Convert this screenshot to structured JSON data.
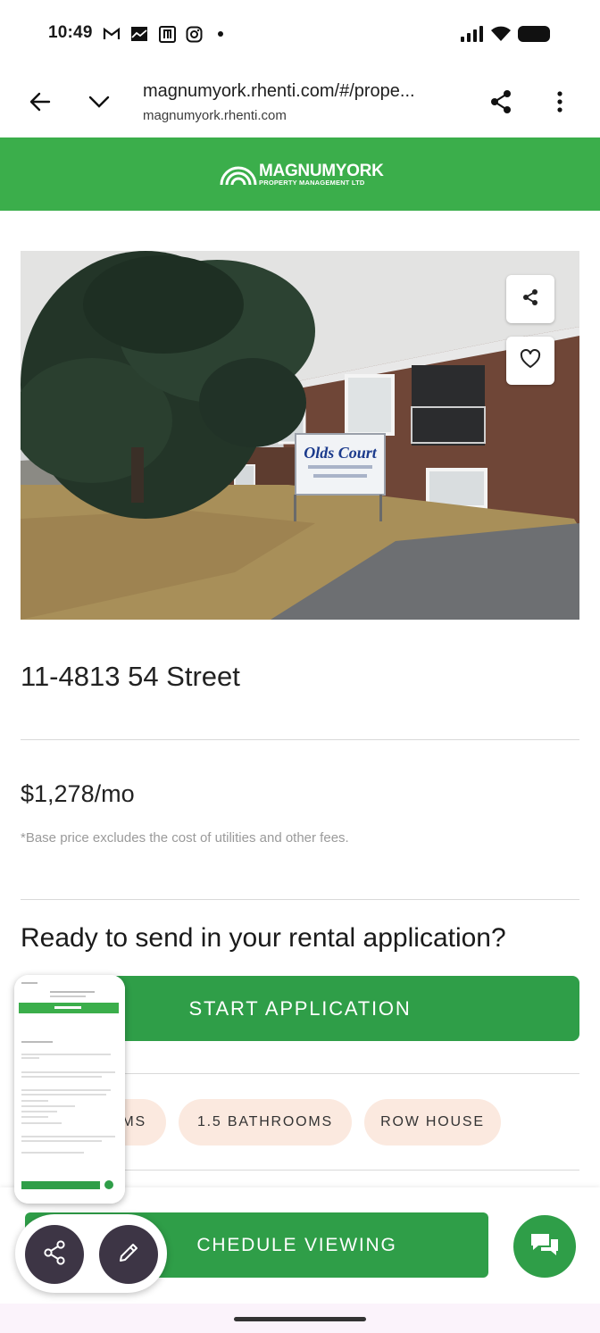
{
  "status_bar": {
    "time": "10:49",
    "notification_icons": [
      "gmail-icon",
      "photos-icon",
      "app-icon",
      "instagram-icon"
    ],
    "system_icons": [
      "signal-icon",
      "wifi-icon",
      "battery-icon"
    ]
  },
  "browser": {
    "url": "magnumyork.rhenti.com/#/prope...",
    "domain": "magnumyork.rhenti.com",
    "icons": [
      "back-arrow-icon",
      "chevron-down-icon",
      "share-icon",
      "more-vert-icon"
    ]
  },
  "site": {
    "logo_name": "MAGNUMYORK",
    "logo_tagline": "PROPERTY MANAGEMENT LTD",
    "brand_color": "#3bae4b"
  },
  "listing": {
    "photo_sign_text": "Olds Court",
    "photo_icons": [
      "share-icon",
      "heart-icon"
    ],
    "address": "11-4813 54 Street",
    "price": "$1,278/mo",
    "price_note": "*Base price excludes the cost of utilities and other fees.",
    "cta_heading": "Ready to send in your rental application?",
    "start_button": "START APPLICATION",
    "features": [
      "MS",
      "1.5 BATHROOMS",
      "ROW HOUSE"
    ],
    "schedule_button": "CHEDULE VIEWING",
    "accent_color": "#2f9e48",
    "chip_color": "#fbe9df"
  },
  "overlay": {
    "tools": [
      "share-icon",
      "edit-icon"
    ]
  }
}
